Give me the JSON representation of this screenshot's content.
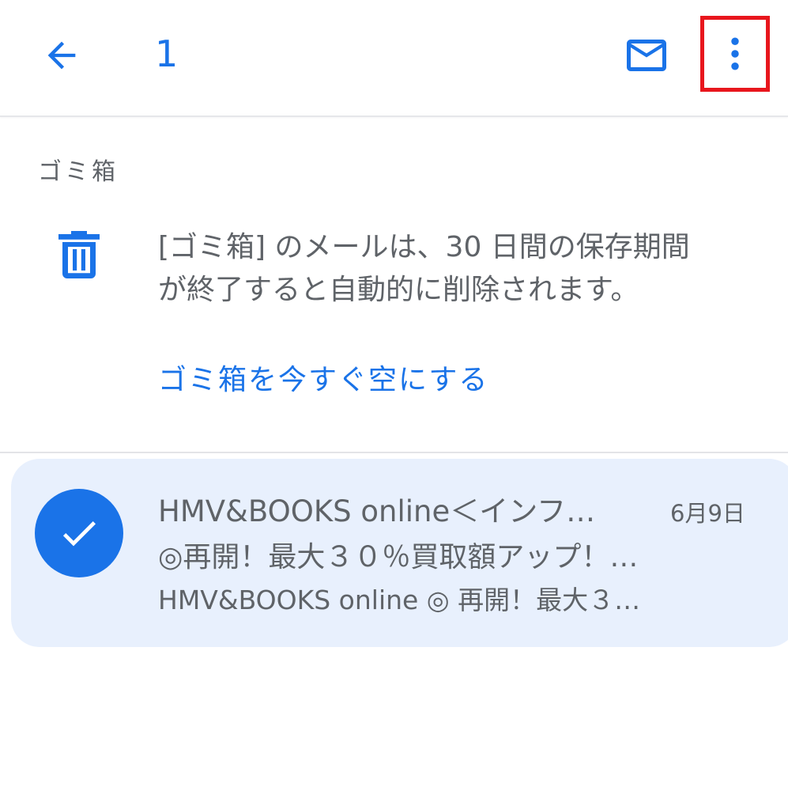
{
  "app_bar": {
    "back_icon": "arrow-back-icon",
    "selected_count": "1",
    "mail_icon": "mail-icon",
    "more_icon": "more-vert-icon",
    "highlight_color": "#e8161d"
  },
  "folder": {
    "label": "ゴミ箱",
    "trash_icon": "trash-icon",
    "info_line_1": "[ゴミ箱] のメールは、30 日間の保存期間",
    "info_line_2": "が終了すると自動的に削除されます。",
    "empty_action": "ゴミ箱を今すぐ空にする"
  },
  "emails": [
    {
      "selected": true,
      "check_icon": "check-icon",
      "sender": "HMV&BOOKS online＜インフ…",
      "date": "6月9日",
      "subject": "◎再開！最大３０％買取額アップ！…",
      "snippet": "HMV&BOOKS online ◎ 再開！最大３…"
    }
  ],
  "colors": {
    "accent": "#1a73e8",
    "text_secondary": "#5f6368",
    "selected_row_bg": "#e8f0fd"
  }
}
